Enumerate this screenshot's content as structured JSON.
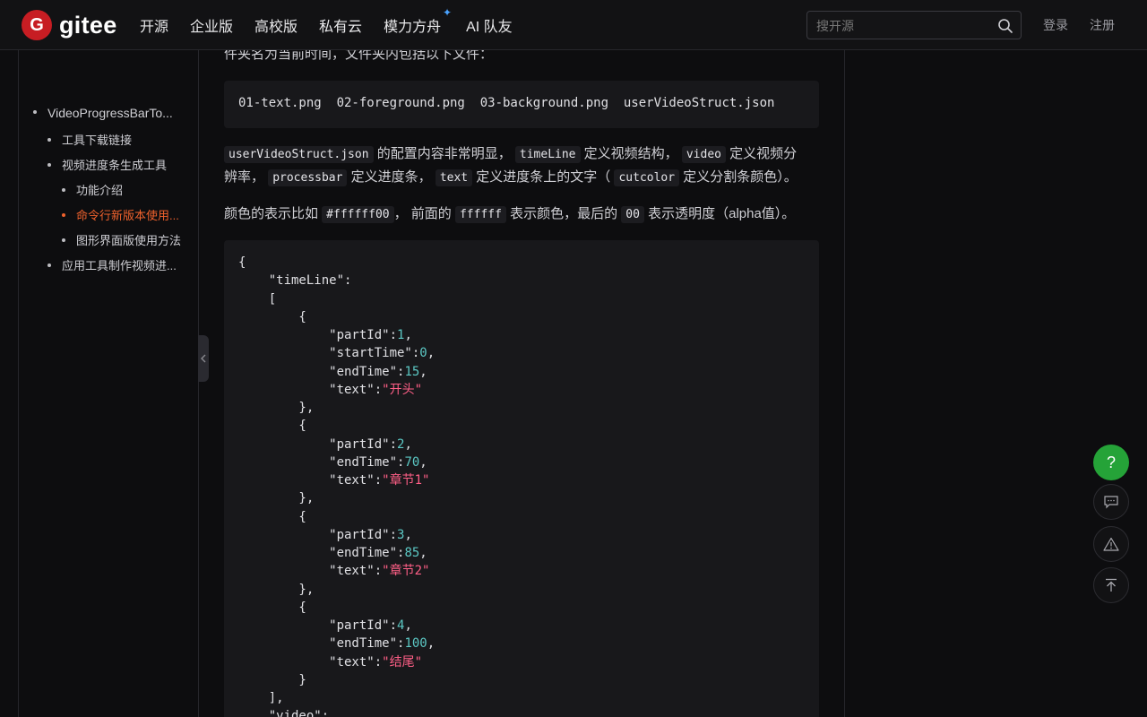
{
  "nav": {
    "logo_mark": "G",
    "logo_text": "gitee",
    "items": [
      "开源",
      "企业版",
      "高校版",
      "私有云",
      "模力方舟",
      "AI 队友"
    ],
    "spark": "✦",
    "search_placeholder": "搜开源",
    "login": "登录",
    "register": "注册"
  },
  "sidebar": {
    "toc": [
      {
        "label": "VideoProgressBarTo...",
        "level": 0,
        "active": false
      },
      {
        "label": "工具下载链接",
        "level": 1,
        "active": false
      },
      {
        "label": "视频进度条生成工具",
        "level": 1,
        "active": false
      },
      {
        "label": "功能介绍",
        "level": 2,
        "active": false
      },
      {
        "label": "命令行新版本使用...",
        "level": 2,
        "active": true
      },
      {
        "label": "图形界面版使用方法",
        "level": 2,
        "active": false
      },
      {
        "label": "应用工具制作视频进...",
        "level": 1,
        "active": false
      }
    ]
  },
  "content": {
    "intro_line": "件夹名为当前时间，文件夹内包括以下文件：",
    "files_line": "01-text.png  02-foreground.png  03-background.png  userVideoStruct.json",
    "p1": {
      "c1": "userVideoStruct.json",
      "t1": " 的配置内容非常明显，",
      "c2": "timeLine",
      "t2": " 定义视频结构，",
      "c3": "video",
      "t3": " 定义视频分",
      "t4": "辨率，",
      "c4": "processbar",
      "t5": " 定义进度条，",
      "c5": "text",
      "t6": " 定义进度条上的文字（",
      "c6": "cutcolor",
      "t7": " 定义分割条颜色）。"
    },
    "p2": {
      "t1": "颜色的表示比如 ",
      "c1": "#ffffff00",
      "t2": "， 前面的 ",
      "c2": "ffffff",
      "t3": " 表示颜色，最后的 ",
      "c3": "00",
      "t4": " 表示透明度（alpha值）。"
    },
    "code": [
      [
        [
          "p",
          "{"
        ]
      ],
      [
        [
          "p",
          "    \"timeLine\":"
        ]
      ],
      [
        [
          "p",
          "    ["
        ]
      ],
      [
        [
          "p",
          "        {"
        ]
      ],
      [
        [
          "p",
          "            \"partId\":"
        ],
        [
          "n",
          "1"
        ],
        [
          "p",
          ","
        ]
      ],
      [
        [
          "p",
          "            \"startTime\":"
        ],
        [
          "n",
          "0"
        ],
        [
          "p",
          ","
        ]
      ],
      [
        [
          "p",
          "            \"endTime\":"
        ],
        [
          "n",
          "15"
        ],
        [
          "p",
          ","
        ]
      ],
      [
        [
          "p",
          "            \"text\":"
        ],
        [
          "s",
          "\"开头\""
        ]
      ],
      [
        [
          "p",
          "        },"
        ]
      ],
      [
        [
          "p",
          "        {"
        ]
      ],
      [
        [
          "p",
          "            \"partId\":"
        ],
        [
          "n",
          "2"
        ],
        [
          "p",
          ","
        ]
      ],
      [
        [
          "p",
          "            \"endTime\":"
        ],
        [
          "n",
          "70"
        ],
        [
          "p",
          ","
        ]
      ],
      [
        [
          "p",
          "            \"text\":"
        ],
        [
          "s",
          "\"章节1\""
        ]
      ],
      [
        [
          "p",
          "        },"
        ]
      ],
      [
        [
          "p",
          "        {"
        ]
      ],
      [
        [
          "p",
          "            \"partId\":"
        ],
        [
          "n",
          "3"
        ],
        [
          "p",
          ","
        ]
      ],
      [
        [
          "p",
          "            \"endTime\":"
        ],
        [
          "n",
          "85"
        ],
        [
          "p",
          ","
        ]
      ],
      [
        [
          "p",
          "            \"text\":"
        ],
        [
          "s",
          "\"章节2\""
        ]
      ],
      [
        [
          "p",
          "        },"
        ]
      ],
      [
        [
          "p",
          "        {"
        ]
      ],
      [
        [
          "p",
          "            \"partId\":"
        ],
        [
          "n",
          "4"
        ],
        [
          "p",
          ","
        ]
      ],
      [
        [
          "p",
          "            \"endTime\":"
        ],
        [
          "n",
          "100"
        ],
        [
          "p",
          ","
        ]
      ],
      [
        [
          "p",
          "            \"text\":"
        ],
        [
          "s",
          "\"结尾\""
        ]
      ],
      [
        [
          "p",
          "        }"
        ]
      ],
      [
        [
          "p",
          "    ],"
        ]
      ],
      [
        [
          "p",
          "    \"video\":"
        ]
      ]
    ]
  },
  "floating": {
    "help": "?",
    "icons": [
      "chat-icon",
      "warning-icon",
      "back-to-top-icon"
    ]
  },
  "colors": {
    "accent_orange": "#f0622d",
    "brand_red": "#c71d23",
    "help_green": "#25a338",
    "code_number": "#5cc9c5",
    "code_string": "#ff5f87"
  }
}
